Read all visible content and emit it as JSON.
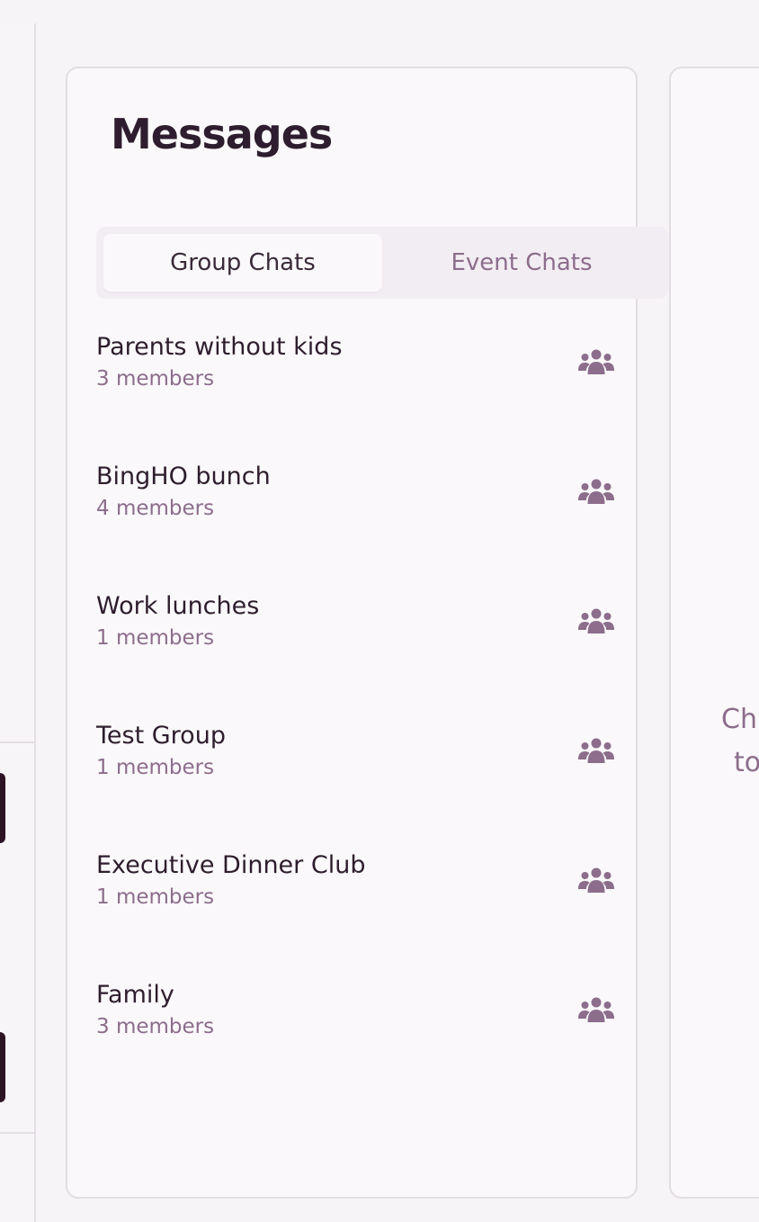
{
  "messages": {
    "title": "Messages",
    "tabs": [
      {
        "label": "Group Chats",
        "active": true
      },
      {
        "label": "Event Chats",
        "active": false
      }
    ],
    "groups": [
      {
        "name": "Parents without kids",
        "members": "3 members",
        "icon": "group-icon"
      },
      {
        "name": "BingHO bunch",
        "members": "4 members",
        "icon": "group-icon"
      },
      {
        "name": "Work lunches",
        "members": "1 members",
        "icon": "group-icon"
      },
      {
        "name": "Test Group",
        "members": "1 members",
        "icon": "group-icon"
      },
      {
        "name": "Executive Dinner Club",
        "members": "1 members",
        "icon": "group-icon"
      },
      {
        "name": "Family",
        "members": "3 members",
        "icon": "group-icon"
      }
    ]
  },
  "chat_panel": {
    "placeholder_line1": "Ch",
    "placeholder_line2": "to"
  },
  "colors": {
    "accent": "#8c6d8c",
    "text": "#2e1d2e",
    "dark_block": "#2d1425",
    "background": "#f6f4f6"
  }
}
